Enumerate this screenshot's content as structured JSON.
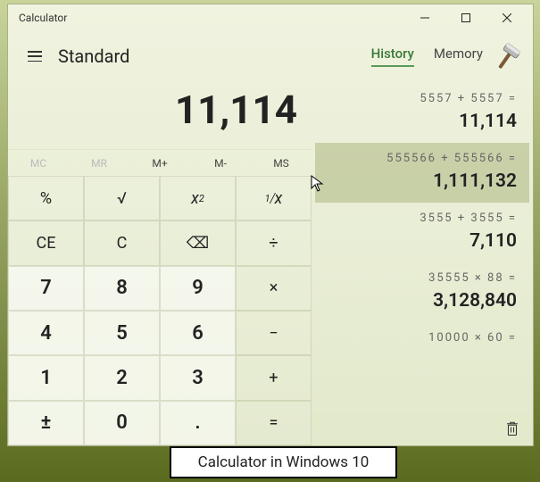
{
  "window": {
    "title": "Calculator"
  },
  "mode": "Standard",
  "tabs": {
    "history": "History",
    "memory": "Memory",
    "active": "history"
  },
  "display": "11,114",
  "memory_buttons": {
    "mc": "MC",
    "mr": "MR",
    "mplus": "M+",
    "mminus": "M-",
    "ms": "MS"
  },
  "keys": {
    "pct": "%",
    "sqrt": "√",
    "sq_base": "x",
    "sq_exp": "2",
    "inv_num": "1",
    "inv_den": "x",
    "ce": "CE",
    "c": "C",
    "bksp": "⌫",
    "div": "÷",
    "7": "7",
    "8": "8",
    "9": "9",
    "mul": "×",
    "4": "4",
    "5": "5",
    "6": "6",
    "sub": "−",
    "1": "1",
    "2": "2",
    "3": "3",
    "add": "+",
    "neg": "±",
    "0": "0",
    "dot": ".",
    "eq": "="
  },
  "history": [
    {
      "expr": "5557  +  5557 =",
      "result": "11,114",
      "selected": false
    },
    {
      "expr": "555566  +  555566 =",
      "result": "1,111,132",
      "selected": true
    },
    {
      "expr": "3555  +  3555 =",
      "result": "7,110",
      "selected": false
    },
    {
      "expr": "35555  ×  88 =",
      "result": "3,128,840",
      "selected": false
    },
    {
      "expr": "10000  ×  60 =",
      "result": "",
      "selected": false
    }
  ],
  "caption": "Calculator in Windows 10"
}
